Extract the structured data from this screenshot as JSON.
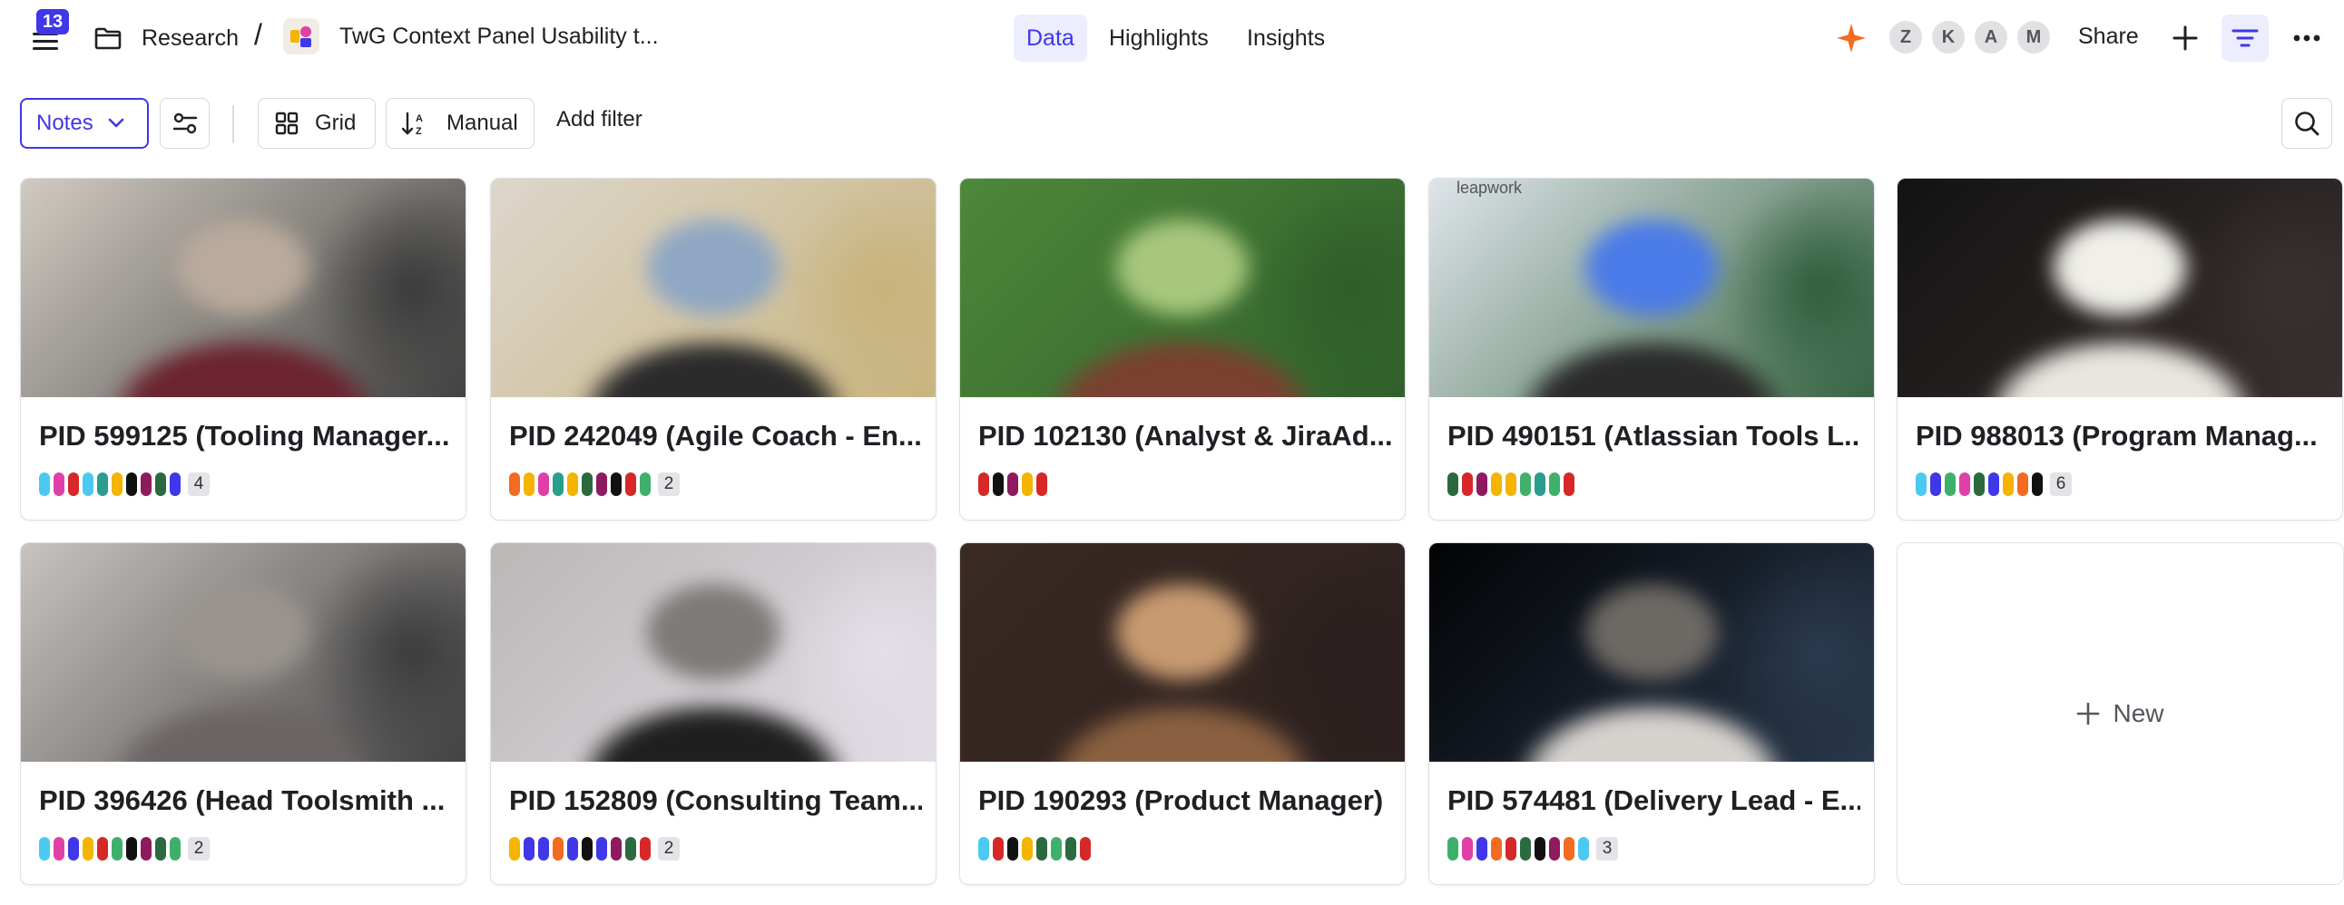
{
  "header": {
    "notification_count": "13",
    "breadcrumb_root": "Research",
    "breadcrumb_separator": "/",
    "project_title": "TwG Context Panel Usability t...",
    "tabs": [
      {
        "label": "Data",
        "active": true
      },
      {
        "label": "Highlights",
        "active": false
      },
      {
        "label": "Insights",
        "active": false
      }
    ],
    "avatars": [
      "Z",
      "K",
      "A",
      "M"
    ],
    "share_label": "Share",
    "accent_color": "#3f37e8",
    "ai_color": "#f26b21"
  },
  "toolbar": {
    "view_select": "Notes",
    "grid_label": "Grid",
    "sort_label": "Manual",
    "add_filter_label": "Add filter"
  },
  "cards": [
    {
      "title": "PID 599125 (Tooling Manager...",
      "tags": [
        "#4cc9f0",
        "#e03fa8",
        "#d62828",
        "#4cc9f0",
        "#2a9d8f",
        "#f4b400",
        "#111111",
        "#8e1b5e",
        "#2b6a3f",
        "#3f37e8"
      ],
      "count": "4",
      "thumb": [
        "#d9d2c9",
        "#6b2430",
        "#3a3a3a",
        "#b9aa9b"
      ]
    },
    {
      "title": "PID 242049 (Agile Coach - En...",
      "tags": [
        "#f26b21",
        "#f4b400",
        "#e03fa8",
        "#2a9d8f",
        "#f4b400",
        "#2b6a3f",
        "#8e1b5e",
        "#111111",
        "#d62828",
        "#3fb06b"
      ],
      "count": "2",
      "thumb": [
        "#ddd8d0",
        "#2b2b2b",
        "#c8b27a",
        "#8fa7c4"
      ]
    },
    {
      "title": "PID 102130 (Analyst & JiraAd...",
      "tags": [
        "#d62828",
        "#111111",
        "#8e1b5e",
        "#f4b400",
        "#d62828"
      ],
      "count": "",
      "thumb": [
        "#4f8a3a",
        "#7a4030",
        "#2f5d2a",
        "#a7c77d"
      ]
    },
    {
      "title": "PID 490151 (Atlassian Tools L...",
      "tags": [
        "#2b6a3f",
        "#d62828",
        "#8e1b5e",
        "#f4b400",
        "#f4b400",
        "#3fb06b",
        "#2a9d8f",
        "#3fb06b",
        "#d62828"
      ],
      "count": "",
      "thumb": [
        "#e8ecf3",
        "#2b2b2b",
        "#2f5d3a",
        "#4b7be8"
      ]
    },
    {
      "title": "PID 988013 (Program Manag...",
      "tags": [
        "#4cc9f0",
        "#3f37e8",
        "#3fb06b",
        "#e03fa8",
        "#2b6a3f",
        "#3f37e8",
        "#f4b400",
        "#f26b21",
        "#111111"
      ],
      "count": "6",
      "thumb": [
        "#111111",
        "#e9e6e0",
        "#3a3030",
        "#f0efe9"
      ]
    },
    {
      "title": "PID 396426 (Head Toolsmith ...",
      "tags": [
        "#4cc9f0",
        "#e03fa8",
        "#3f37e8",
        "#f4b400",
        "#d62828",
        "#3fb06b",
        "#111111",
        "#8e1b5e",
        "#2b6a3f",
        "#3fb06b"
      ],
      "count": "2",
      "thumb": [
        "#cfcac6",
        "#6c6464",
        "#3b3b3b",
        "#9a948e"
      ]
    },
    {
      "title": "PID 152809 (Consulting Team...",
      "tags": [
        "#f4b400",
        "#3f37e8",
        "#3f37e8",
        "#f26b21",
        "#3f37e8",
        "#111111",
        "#3f37e8",
        "#8e1b5e",
        "#2b6a3f",
        "#d62828"
      ],
      "count": "2",
      "thumb": [
        "#b8b5b4",
        "#1f1f1f",
        "#e5dfe8",
        "#7d7a78"
      ]
    },
    {
      "title": "PID 190293 (Product Manager)",
      "tags": [
        "#4cc9f0",
        "#d62828",
        "#111111",
        "#f4b400",
        "#2b6a3f",
        "#3fb06b",
        "#2b6a3f",
        "#d62828"
      ],
      "count": "",
      "thumb": [
        "#3a2a22",
        "#8a6040",
        "#2b2020",
        "#c89a70"
      ]
    },
    {
      "title": "PID 574481 (Delivery Lead - E...",
      "tags": [
        "#3fb06b",
        "#e03fa8",
        "#3f37e8",
        "#f26b21",
        "#d62828",
        "#2b6a3f",
        "#111111",
        "#8e1b5e",
        "#f26b21",
        "#4cc9f0"
      ],
      "count": "3",
      "thumb": [
        "#000000",
        "#d6d2ce",
        "#2b3a4f",
        "#6c6864"
      ]
    }
  ],
  "card_watermark": "leapwork",
  "new_card_label": "New"
}
